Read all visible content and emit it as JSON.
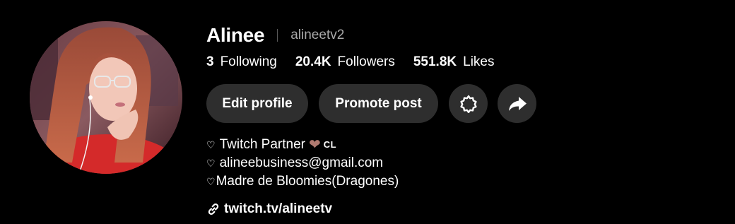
{
  "profile": {
    "display_name": "Alinee",
    "username": "alineetv2",
    "stats": {
      "following_count": "3",
      "following_label": "Following",
      "followers_count": "20.4K",
      "followers_label": "Followers",
      "likes_count": "551.8K",
      "likes_label": "Likes"
    },
    "buttons": {
      "edit_profile": "Edit profile",
      "promote_post": "Promote post",
      "settings_icon": "settings-gear-icon",
      "share_icon": "share-arrow-icon"
    },
    "bio": {
      "line1_symbol": "♡",
      "line1_text": "Twitch Partner",
      "line1_emoji": "brown-heart-emoji",
      "line1_flag": "CL",
      "line2_symbol": "♡",
      "line2_text": "alineebusiness@gmail.com",
      "line3_symbol": "♡",
      "line3_text": "Madre de Bloomies(Dragones)"
    },
    "link": {
      "icon": "link-icon",
      "text": "twitch.tv/alineetv"
    }
  },
  "colors": {
    "background": "#000000",
    "button_bg": "#2e2e2e",
    "text_primary": "#ffffff",
    "text_secondary": "#a9a9a9",
    "brown_heart": "#b07a70"
  }
}
